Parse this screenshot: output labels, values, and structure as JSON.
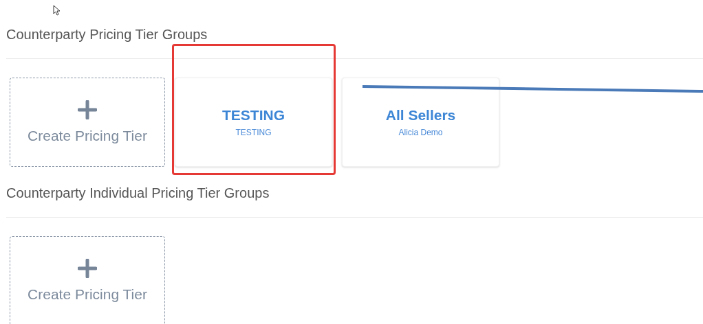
{
  "sections": [
    {
      "title": "Counterparty Pricing Tier Groups",
      "cards": [
        {
          "kind": "create",
          "label": "Create Pricing Tier"
        },
        {
          "kind": "group",
          "title": "TESTING",
          "subtitle": "TESTING"
        },
        {
          "kind": "group",
          "title": "All Sellers",
          "subtitle": "Alicia Demo"
        }
      ]
    },
    {
      "title": "Counterparty Individual Pricing Tier Groups",
      "cards": [
        {
          "kind": "create",
          "label": "Create Pricing Tier"
        }
      ]
    }
  ]
}
